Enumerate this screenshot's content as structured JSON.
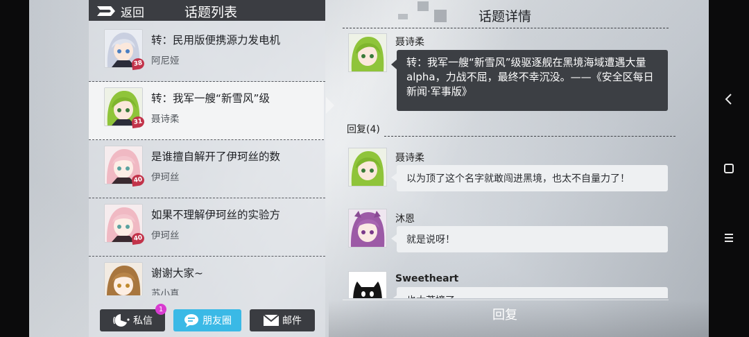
{
  "header": {
    "back_label": "返回",
    "list_title": "话题列表"
  },
  "topics": [
    {
      "title": "转：民用版便携源力发电机",
      "author": "阿尼娅",
      "badge": "38",
      "avatar": "silver-hair-girl-avatar"
    },
    {
      "title": "转：我军一艘“新雪风”级",
      "author": "聂诗柔",
      "badge": "31",
      "avatar": "green-hair-girl-avatar",
      "selected": true
    },
    {
      "title": "是谁擅自解开了伊珂丝的数",
      "author": "伊珂丝",
      "badge": "40",
      "avatar": "pink-hair-girl-avatar"
    },
    {
      "title": "如果不理解伊珂丝的实验方",
      "author": "伊珂丝",
      "badge": "40",
      "avatar": "pink-hair-girl-avatar"
    },
    {
      "title": "谢谢大家~",
      "author": "苏小真",
      "badge": "",
      "avatar": "brown-hair-girl-avatar"
    }
  ],
  "bottom_bar": {
    "messages_label": "私信",
    "messages_notification": "1",
    "moments_label": "朋友圈",
    "mail_label": "邮件"
  },
  "detail": {
    "title": "话题详情",
    "poster": "聂诗柔",
    "post_text": "转：我军一艘“新雪风”级驱逐舰在黑境海域遭遇大量alpha，力战不屈，最终不幸沉没。——《安全区每日新闻·军事版》",
    "reply_count_label": "回复(4)",
    "replies": [
      {
        "name": "聂诗柔",
        "text": "以为顶了这个名字就敢闯进黑境，也太不自量力了！"
      },
      {
        "name": "沐恩",
        "text": "就是说呀！"
      },
      {
        "name": "Sweetheart",
        "text": "也太莽撞了……"
      }
    ],
    "reply_button": "回复"
  },
  "colors": {
    "dark": "#3c3f44",
    "accent": "#3ab9e6",
    "badge": "#c2334a",
    "notification": "#d83bd0"
  }
}
